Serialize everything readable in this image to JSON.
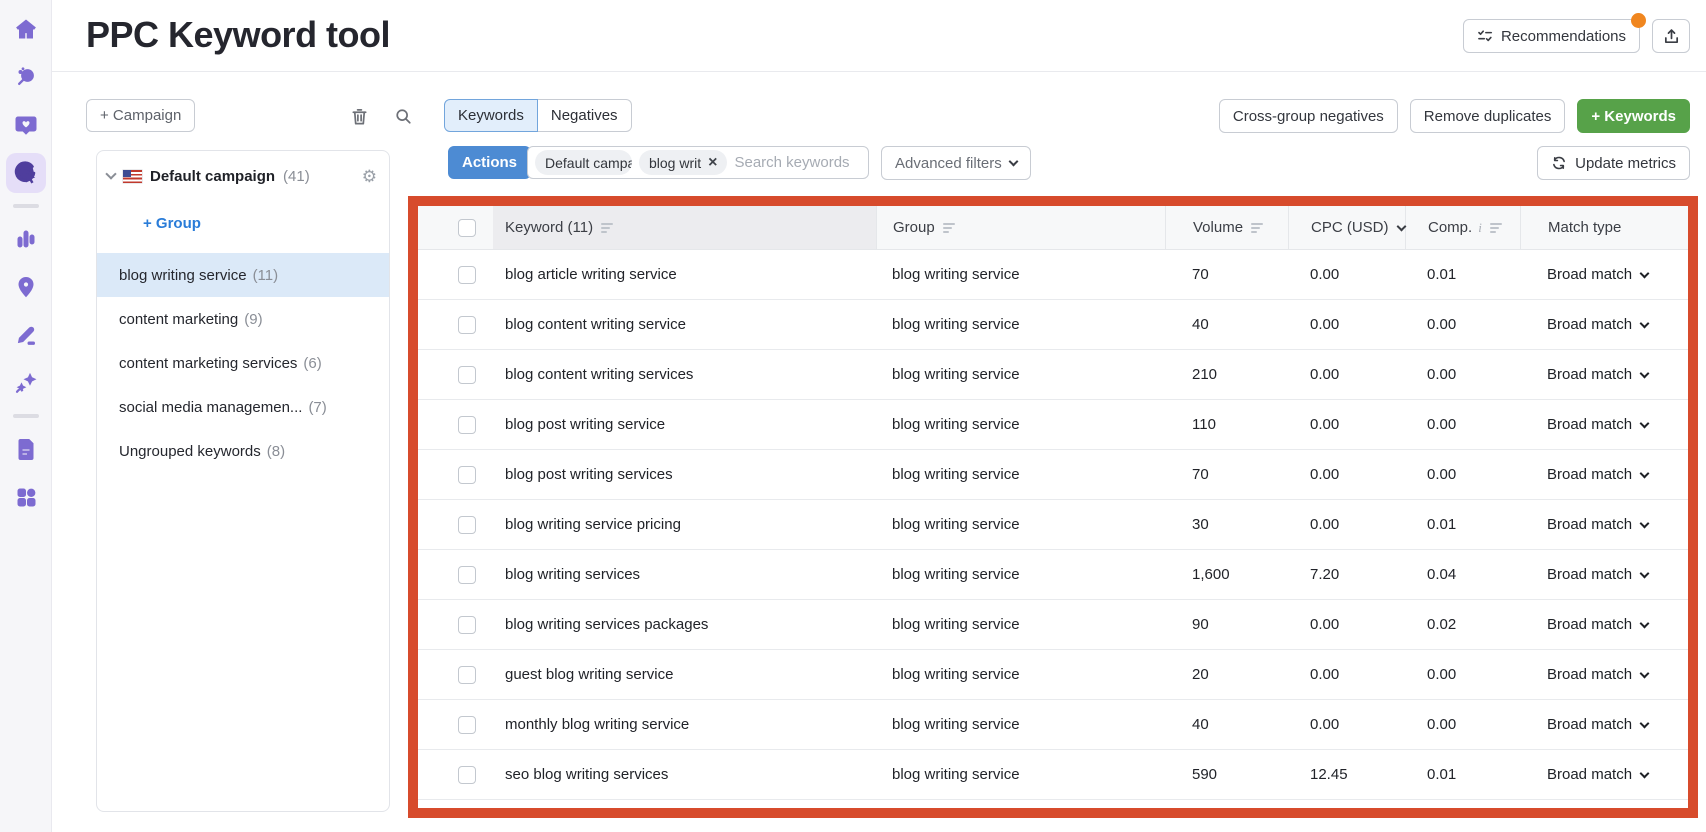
{
  "header": {
    "title": "PPC Keyword tool",
    "recommendations_label": "Recommendations",
    "notification_dot_color": "#f0861f"
  },
  "sidebar_icons": [
    {
      "name": "home-icon"
    },
    {
      "name": "keyword-research-icon"
    },
    {
      "name": "social-media-icon"
    },
    {
      "name": "advertising-icon",
      "active": true
    },
    {
      "name": "analytics-icon"
    },
    {
      "name": "local-map-pin-icon"
    },
    {
      "name": "content-pencil-icon"
    },
    {
      "name": "ai-sparkles-icon"
    },
    {
      "name": "reports-icon"
    },
    {
      "name": "apps-grid-icon"
    }
  ],
  "panel": {
    "campaign_button_label": "+ Campaign",
    "campaign": {
      "name": "Default campaign",
      "count": "(41)"
    },
    "add_group_label": "+ Group",
    "groups": [
      {
        "label": "blog writing service",
        "count": "(11)",
        "selected": true
      },
      {
        "label": "content marketing",
        "count": "(9)",
        "selected": false
      },
      {
        "label": "content marketing services",
        "count": "(6)",
        "selected": false
      },
      {
        "label": "social media managemen...",
        "count": "(7)",
        "selected": false
      },
      {
        "label": "Ungrouped keywords",
        "count": "(8)",
        "selected": false
      }
    ]
  },
  "toolbar": {
    "tabs": [
      {
        "label": "Keywords",
        "active": true
      },
      {
        "label": "Negatives",
        "active": false
      }
    ],
    "cross_group_label": "Cross-group negatives",
    "remove_duplicates_label": "Remove duplicates",
    "add_keywords_label": "+ Keywords",
    "actions_label": "Actions",
    "filter_chips": [
      "Default campa",
      "blog writ"
    ],
    "search_placeholder": "Search keywords",
    "advanced_filters_label": "Advanced filters",
    "update_metrics_label": "Update metrics"
  },
  "table": {
    "columns": {
      "keyword": "Keyword (11)",
      "group": "Group",
      "volume": "Volume",
      "cpc": "CPC (USD)",
      "comp": "Comp.",
      "match": "Match type"
    },
    "rows": [
      {
        "keyword": "blog article writing service",
        "group": "blog writing service",
        "volume": "70",
        "cpc": "0.00",
        "comp": "0.01",
        "match": "Broad match"
      },
      {
        "keyword": "blog content writing service",
        "group": "blog writing service",
        "volume": "40",
        "cpc": "0.00",
        "comp": "0.00",
        "match": "Broad match"
      },
      {
        "keyword": "blog content writing services",
        "group": "blog writing service",
        "volume": "210",
        "cpc": "0.00",
        "comp": "0.00",
        "match": "Broad match"
      },
      {
        "keyword": "blog post writing service",
        "group": "blog writing service",
        "volume": "110",
        "cpc": "0.00",
        "comp": "0.00",
        "match": "Broad match"
      },
      {
        "keyword": "blog post writing services",
        "group": "blog writing service",
        "volume": "70",
        "cpc": "0.00",
        "comp": "0.00",
        "match": "Broad match"
      },
      {
        "keyword": "blog writing service pricing",
        "group": "blog writing service",
        "volume": "30",
        "cpc": "0.00",
        "comp": "0.01",
        "match": "Broad match"
      },
      {
        "keyword": "blog writing services",
        "group": "blog writing service",
        "volume": "1,600",
        "cpc": "7.20",
        "comp": "0.04",
        "match": "Broad match"
      },
      {
        "keyword": "blog writing services packages",
        "group": "blog writing service",
        "volume": "90",
        "cpc": "0.00",
        "comp": "0.02",
        "match": "Broad match"
      },
      {
        "keyword": "guest blog writing service",
        "group": "blog writing service",
        "volume": "20",
        "cpc": "0.00",
        "comp": "0.00",
        "match": "Broad match"
      },
      {
        "keyword": "monthly blog writing service",
        "group": "blog writing service",
        "volume": "40",
        "cpc": "0.00",
        "comp": "0.00",
        "match": "Broad match"
      },
      {
        "keyword": "seo blog writing services",
        "group": "blog writing service",
        "volume": "590",
        "cpc": "12.45",
        "comp": "0.01",
        "match": "Broad match"
      }
    ]
  },
  "colors": {
    "highlight_border": "#d74b2c",
    "primary_blue": "#4d8bd3",
    "action_green": "#57a249",
    "brand_purple": "#7d6bd1",
    "selected_group_bg": "#dbe9f8",
    "active_tab_bg": "#e2eefb",
    "notification_orange": "#f0861f"
  }
}
